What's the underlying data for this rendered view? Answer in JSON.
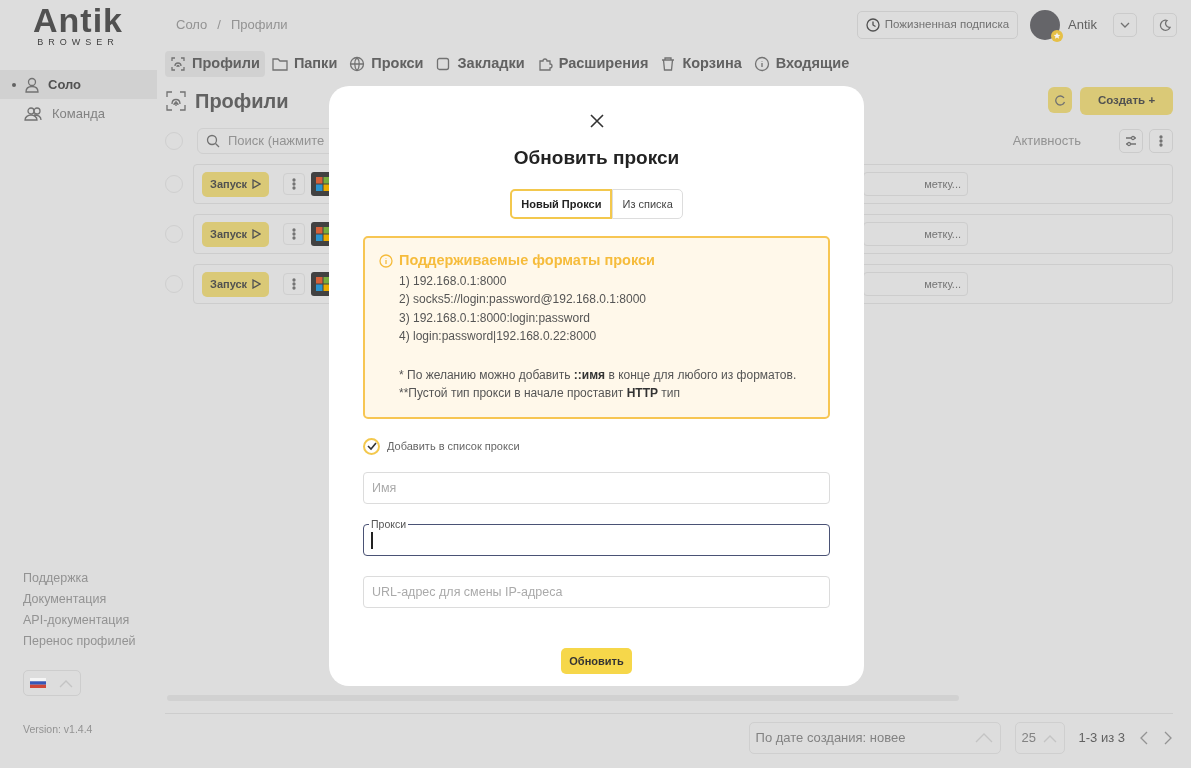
{
  "header": {
    "logo_word": "Antik",
    "logo_sub": "BROWSER",
    "breadcrumbs": [
      "Соло",
      "Профили"
    ],
    "breadcrumb_separator": "/",
    "subscription": "Пожизненная подписка",
    "user": "Antik"
  },
  "sidebar": {
    "items": [
      {
        "label": "Соло",
        "selected": true
      },
      {
        "label": "Команда",
        "selected": false
      }
    ],
    "links": [
      "Поддержка",
      "Документация",
      "API-документация",
      "Перенос профилей"
    ],
    "version": "Version: v1.4.4"
  },
  "tabs": [
    {
      "label": "Профили",
      "selected": true
    },
    {
      "label": "Папки",
      "selected": false
    },
    {
      "label": "Прокси",
      "selected": false
    },
    {
      "label": "Закладки",
      "selected": false
    },
    {
      "label": "Расширения",
      "selected": false
    },
    {
      "label": "Корзина",
      "selected": false
    },
    {
      "label": "Входящие",
      "selected": false
    }
  ],
  "page": {
    "title": "Профили",
    "select_all_checked": false,
    "search_placeholder": "Поиск (нажмите",
    "activity": "Активность",
    "create_button": "Создать +"
  },
  "rows": [
    {
      "checked": false,
      "launch": "Запуск",
      "note": "метку..."
    },
    {
      "checked": false,
      "launch": "Запуск",
      "note": "метку..."
    },
    {
      "checked": false,
      "launch": "Запуск",
      "note": "метку..."
    }
  ],
  "footer": {
    "sort": "По дате создания: новее",
    "per_page": "25",
    "range": "1-3 из 3"
  },
  "modal": {
    "title": "Обновить прокси",
    "tabs": [
      {
        "label": "Новый Прокси",
        "selected": true
      },
      {
        "label": "Из списка",
        "selected": false
      }
    ],
    "info_title": "Поддерживаемые форматы прокси",
    "formats": [
      "1) 192.168.0.1:8000",
      "2) socks5://login:password@192.168.0.1:8000",
      "3) 192.168.0.1:8000:login:password",
      "4) login:password|192.168.0.22:8000"
    ],
    "notes": [
      [
        {
          "text": "* По желанию можно добавить ",
          "bold": false
        },
        {
          "text": "::имя",
          "bold": true
        },
        {
          "text": " в конце для любого из форматов.",
          "bold": false
        }
      ],
      [
        {
          "text": "**Пустой тип прокси в начале проставит ",
          "bold": false
        },
        {
          "text": "HTTP",
          "bold": true
        },
        {
          "text": " тип",
          "bold": false
        }
      ]
    ],
    "checkbox": {
      "label": "Добавить в список прокси",
      "checked": true
    },
    "fields": [
      {
        "kind": "plain",
        "placeholder": "Имя"
      },
      {
        "kind": "floating",
        "label": "Прокси",
        "focused": true
      },
      {
        "kind": "plain",
        "placeholder": "URL-адрес для смены IP-адреса"
      }
    ],
    "submit": "Обновить"
  }
}
